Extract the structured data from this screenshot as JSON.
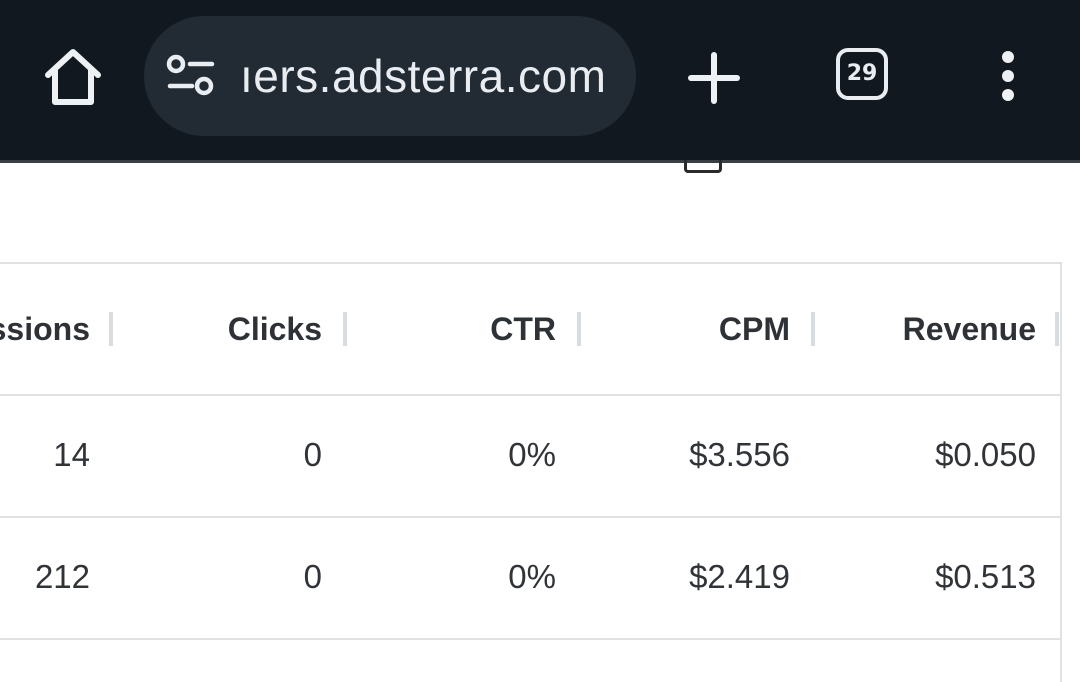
{
  "browser": {
    "url_text": "ıers.adsterra.com",
    "tab_count": "29",
    "icons": [
      "home-icon",
      "site-settings-icon",
      "plus-icon",
      "tab-switcher-icon",
      "more-vert-icon"
    ]
  },
  "table": {
    "columns": [
      "ssions",
      "Clicks",
      "CTR",
      "CPM",
      "Revenue"
    ],
    "rows": [
      [
        "14",
        "0",
        "0%",
        "$3.556",
        "$0.050"
      ],
      [
        "212",
        "0",
        "0%",
        "$2.419",
        "$0.513"
      ]
    ]
  }
}
